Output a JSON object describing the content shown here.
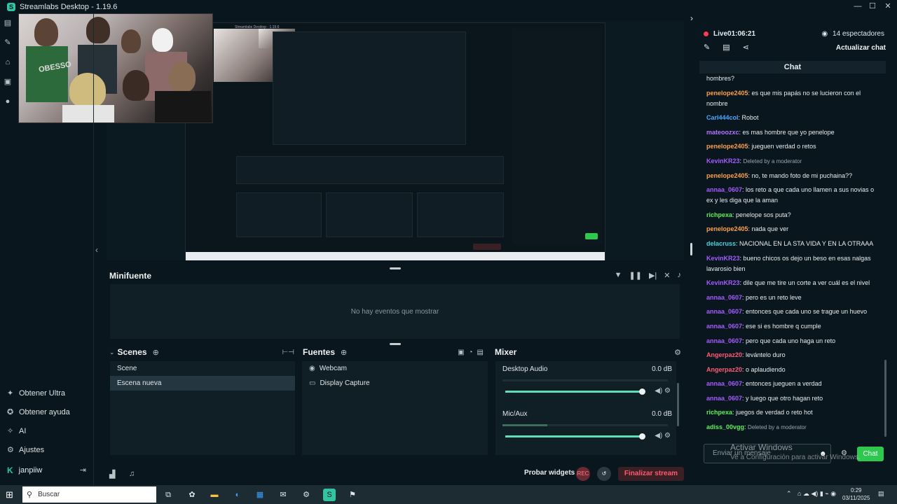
{
  "window": {
    "title": "Streamlabs Desktop - 1.19.6",
    "minimize": "—",
    "maximize": "☐",
    "close": "✕"
  },
  "sidebar": {
    "items": [
      {
        "label": "Obtener Ultra",
        "icon": "ultra-icon"
      },
      {
        "label": "Obtener ayuda",
        "icon": "help-icon"
      },
      {
        "label": "AI",
        "icon": "ai-icon"
      },
      {
        "label": "Ajustes",
        "icon": "settings-icon"
      }
    ],
    "user": "janpiiw"
  },
  "preview": {
    "nested_title": "Streamlabs Desktop - 1.19.6",
    "nested_sign": "OBESSO"
  },
  "minifuente": {
    "title": "Minifuente",
    "empty": "No hay eventos que mostrar"
  },
  "scenes": {
    "title": "Scenes",
    "items": [
      "Scene",
      "Escena nueva"
    ]
  },
  "sources": {
    "title": "Fuentes",
    "items": [
      {
        "label": "Webcam",
        "icon": "webcam-icon"
      },
      {
        "label": "Display Capture",
        "icon": "monitor-icon"
      }
    ]
  },
  "mixer": {
    "title": "Mixer",
    "channels": [
      {
        "name": "Desktop Audio",
        "db": "0.0 dB",
        "level": 0.0,
        "volume": 1.0
      },
      {
        "name": "Mic/Aux",
        "db": "0.0 dB",
        "level": 0.27,
        "volume": 1.0
      }
    ]
  },
  "footer": {
    "test_widgets": "Probar widgets",
    "rec": "REC",
    "end_stream": "Finalizar stream"
  },
  "live": {
    "status": "Live",
    "time": "01:06:21",
    "viewers": "14 espectadores",
    "update_chat": "Actualizar chat"
  },
  "chat": {
    "title": "Chat",
    "messages": [
      {
        "user": "",
        "text": "hombres?",
        "color": "#e8edef"
      },
      {
        "user": "penelope2405",
        "text": ": es que mis papás no se lucieron con el nombre",
        "color": "#ffa14a"
      },
      {
        "user": "Carl444col",
        "text": ": Robot",
        "color": "#4aa8ff"
      },
      {
        "user": "mateoozxc",
        "text": ": es mas hombre que yo penelope",
        "color": "#b574ff"
      },
      {
        "user": "penelope2405",
        "text": ": jueguen verdad o retos",
        "color": "#ffa14a"
      },
      {
        "user": "KevinKR23",
        "text": ": ",
        "deleted": "Deleted by a moderator",
        "color": "#a55cff"
      },
      {
        "user": "penelope2405",
        "text": ": no, te mando foto de mi puchaina??",
        "color": "#ffa14a"
      },
      {
        "user": "annaa_0607",
        "text": ": los reto a que cada uno llamen a sus novias o ex y les diga que la aman",
        "color": "#a55cff"
      },
      {
        "user": "richpexa",
        "text": ": penelope sos puta?",
        "color": "#5df05a"
      },
      {
        "user": "penelope2405",
        "text": ": nada que ver",
        "color": "#ffa14a"
      },
      {
        "user": "delacruss",
        "text": ": NACIONAL EN LA STA VIDA Y EN LA OTRAAA",
        "color": "#47d3e0"
      },
      {
        "user": "KevinKR23",
        "text": ": bueno chicos os dejo un beso en esas nalgas lavarosio bien",
        "color": "#a55cff"
      },
      {
        "user": "KevinKR23",
        "text": ": dile que me tire un corte a ver cuál es el nivel",
        "color": "#a55cff"
      },
      {
        "user": "annaa_0607",
        "text": ": pero es un reto leve",
        "color": "#a55cff"
      },
      {
        "user": "annaa_0607",
        "text": ": entonces que cada uno se trague un huevo",
        "color": "#a55cff"
      },
      {
        "user": "annaa_0607",
        "text": ": ese si es hombre q cumple",
        "color": "#a55cff"
      },
      {
        "user": "annaa_0607",
        "text": ": pero que cada uno haga un reto",
        "color": "#a55cff"
      },
      {
        "user": "Angerpaz20",
        "text": ": levántelo duro",
        "color": "#ff5a76"
      },
      {
        "user": "Angerpaz20",
        "text": ": o aplaudiendo",
        "color": "#ff5a76"
      },
      {
        "user": "annaa_0607",
        "text": ": entonces jueguen a verdad",
        "color": "#a55cff"
      },
      {
        "user": "annaa_0607",
        "text": ": y luego que otro hagan reto",
        "color": "#a55cff"
      },
      {
        "user": "richpexa",
        "text": ": juegos de verdad o reto hot",
        "color": "#5df05a"
      },
      {
        "user": "adiss_00vgg",
        "text": ": ",
        "deleted": "Deleted by a moderator",
        "color": "#5df05a"
      }
    ],
    "input_placeholder": "Enviar un mensaje",
    "send_label": "Chat"
  },
  "watermark": {
    "line1": "Activar Windows",
    "line2": "Ve a Configuración para activar Windows."
  },
  "taskbar": {
    "search_placeholder": "Buscar",
    "time": "0:29",
    "date": "03/11/2025"
  }
}
